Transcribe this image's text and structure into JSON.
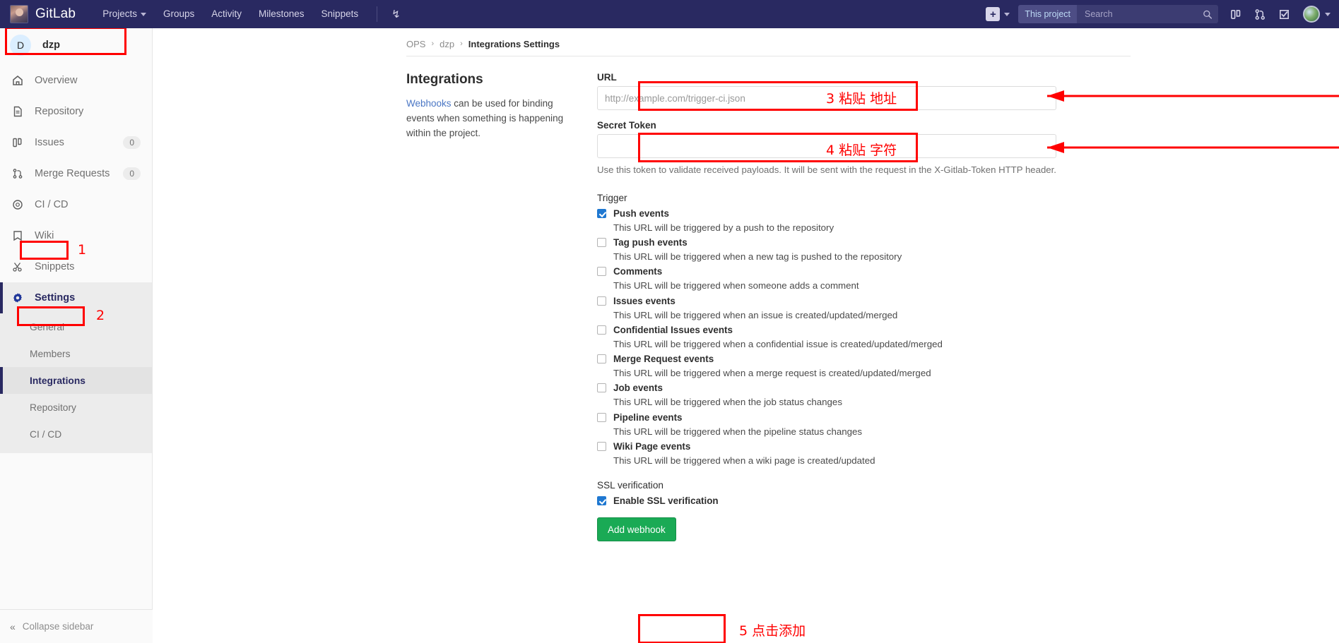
{
  "topnav": {
    "brand": "GitLab",
    "links": [
      {
        "label": "Projects",
        "has_caret": true
      },
      {
        "label": "Groups",
        "has_caret": false
      },
      {
        "label": "Activity",
        "has_caret": false
      },
      {
        "label": "Milestones",
        "has_caret": false
      },
      {
        "label": "Snippets",
        "has_caret": false
      }
    ],
    "plus_label": "+",
    "search_scope": "This project",
    "search_placeholder": "Search",
    "icons": [
      "search-icon",
      "issue-boards-icon",
      "merge-requests-icon",
      "todos-icon",
      "user-avatar"
    ]
  },
  "sidebar": {
    "project_initial": "D",
    "project_name": "dzp",
    "items": [
      {
        "label": "Overview",
        "icon": "home-icon",
        "badge": null
      },
      {
        "label": "Repository",
        "icon": "document-icon",
        "badge": null
      },
      {
        "label": "Issues",
        "icon": "issues-icon",
        "badge": "0"
      },
      {
        "label": "Merge Requests",
        "icon": "merge-icon",
        "badge": "0"
      },
      {
        "label": "CI / CD",
        "icon": "rocket-icon",
        "badge": null
      },
      {
        "label": "Wiki",
        "icon": "book-icon",
        "badge": null
      },
      {
        "label": "Snippets",
        "icon": "scissors-icon",
        "badge": null
      },
      {
        "label": "Settings",
        "icon": "gear-icon",
        "badge": null,
        "active": true
      }
    ],
    "subitems": [
      {
        "label": "General"
      },
      {
        "label": "Members"
      },
      {
        "label": "Integrations",
        "current": true
      },
      {
        "label": "Repository"
      },
      {
        "label": "CI / CD"
      }
    ],
    "collapse_label": "Collapse sidebar"
  },
  "breadcrumb": {
    "group": "OPS",
    "project": "dzp",
    "page": "Integrations Settings",
    "separator": "›"
  },
  "intro": {
    "heading": "Integrations",
    "link_text": "Webhooks",
    "body": " can be used for binding events when something is happening within the project."
  },
  "form": {
    "url_label": "URL",
    "url_placeholder": "http://example.com/trigger-ci.json",
    "url_value": "",
    "token_label": "Secret Token",
    "token_placeholder": "",
    "token_value": "",
    "token_help": "Use this token to validate received payloads. It will be sent with the request in the X-Gitlab-Token HTTP header.",
    "trigger_label": "Trigger",
    "triggers": [
      {
        "label": "Push events",
        "checked": true,
        "desc": "This URL will be triggered by a push to the repository"
      },
      {
        "label": "Tag push events",
        "checked": false,
        "desc": "This URL will be triggered when a new tag is pushed to the repository"
      },
      {
        "label": "Comments",
        "checked": false,
        "desc": "This URL will be triggered when someone adds a comment"
      },
      {
        "label": "Issues events",
        "checked": false,
        "desc": "This URL will be triggered when an issue is created/updated/merged"
      },
      {
        "label": "Confidential Issues events",
        "checked": false,
        "desc": "This URL will be triggered when a confidential issue is created/updated/merged"
      },
      {
        "label": "Merge Request events",
        "checked": false,
        "desc": "This URL will be triggered when a merge request is created/updated/merged"
      },
      {
        "label": "Job events",
        "checked": false,
        "desc": "This URL will be triggered when the job status changes"
      },
      {
        "label": "Pipeline events",
        "checked": false,
        "desc": "This URL will be triggered when the pipeline status changes"
      },
      {
        "label": "Wiki Page events",
        "checked": false,
        "desc": "This URL will be triggered when a wiki page is created/updated"
      }
    ],
    "ssl_label": "SSL verification",
    "ssl_checkbox_label": "Enable SSL verification",
    "ssl_checked": true,
    "submit_label": "Add webhook"
  },
  "annotations": {
    "color": "#ff0000",
    "step1": "1",
    "step2": "2",
    "step3": "3 粘贴 地址",
    "step4": "4 粘贴 字符",
    "step5": "5 点击添加"
  }
}
